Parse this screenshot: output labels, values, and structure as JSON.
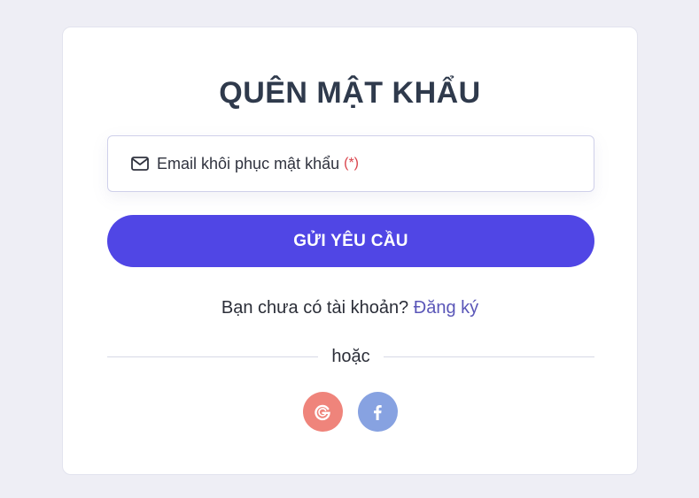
{
  "form": {
    "title": "QUÊN MẬT KHẨU",
    "email_field": {
      "label": "Email khôi phục mật khẩu",
      "required_marker": "(*)",
      "icon": "mail-icon"
    },
    "submit_label": "GỬI YÊU CẦU",
    "signup_prompt": "Bạn chưa có tài khoản?",
    "signup_link": "Đăng ký",
    "divider_text": "hoặc"
  },
  "social": [
    {
      "name": "google",
      "icon": "google-icon",
      "color": "#ef847b"
    },
    {
      "name": "facebook",
      "icon": "facebook-icon",
      "color": "#87a2e1"
    }
  ],
  "colors": {
    "background": "#eeeef5",
    "card": "#ffffff",
    "primary": "#5046e5",
    "title": "#2f3a4c",
    "link": "#5a56b8",
    "required": "#d9434b"
  }
}
